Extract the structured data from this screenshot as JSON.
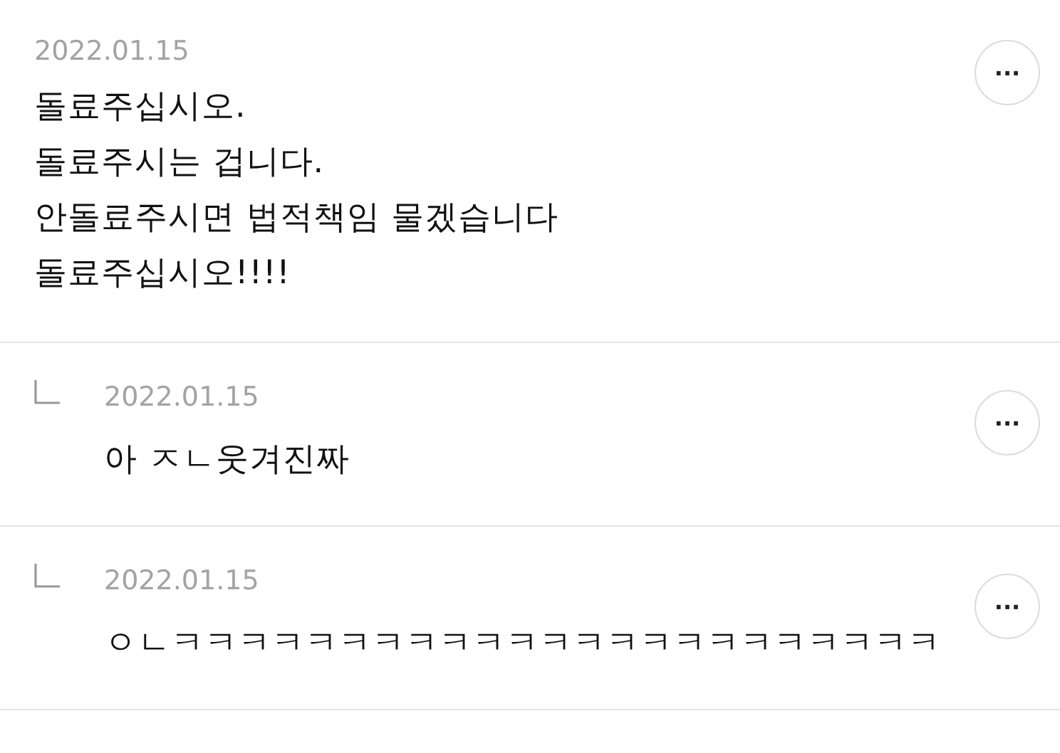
{
  "comments": [
    {
      "kind": "comment",
      "date": "2022.01.15",
      "more": "···",
      "lines": [
        "돌료주십시오.",
        "돌료주시는 겁니다.",
        "안돌료주시면 법적책임 물겠습니다",
        "돌료주십시오!!!!"
      ]
    },
    {
      "kind": "reply",
      "date": "2022.01.15",
      "more": "···",
      "lines": [
        "아 ㅈㄴ웃겨진짜"
      ]
    },
    {
      "kind": "reply",
      "date": "2022.01.15",
      "more": "···",
      "lines": [
        "ㅇㄴㅋㅋㅋㅋㅋㅋㅋㅋㅋㅋㅋㅋㅋㅋㅋㅋㅋㅋㅋㅋㅋㅋㅋ"
      ]
    }
  ]
}
